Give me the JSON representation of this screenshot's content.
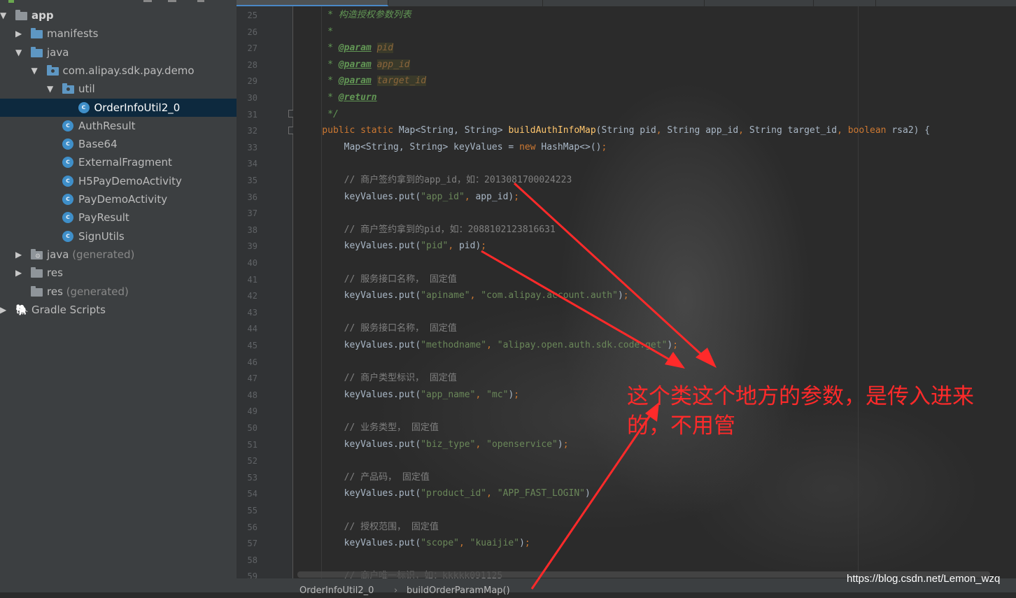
{
  "project_tree": {
    "nodes": [
      {
        "label": "app",
        "depth": 0,
        "icon": "module-folder-icon",
        "arrow": "▼"
      },
      {
        "label": "manifests",
        "depth": 1,
        "icon": "folder-icon",
        "arrow": "▶"
      },
      {
        "label": "java",
        "depth": 1,
        "icon": "folder-icon",
        "arrow": "▼"
      },
      {
        "label": "com.alipay.sdk.pay.demo",
        "depth": 2,
        "icon": "package-icon",
        "arrow": "▼"
      },
      {
        "label": "util",
        "depth": 3,
        "icon": "package-icon",
        "arrow": "▼"
      },
      {
        "label": "OrderInfoUtil2_0",
        "depth": 4,
        "icon": "class-icon",
        "selected": true
      },
      {
        "label": "AuthResult",
        "depth": 3,
        "icon": "class-icon"
      },
      {
        "label": "Base64",
        "depth": 3,
        "icon": "class-icon"
      },
      {
        "label": "ExternalFragment",
        "depth": 3,
        "icon": "class-icon"
      },
      {
        "label": "H5PayDemoActivity",
        "depth": 3,
        "icon": "class-icon"
      },
      {
        "label": "PayDemoActivity",
        "depth": 3,
        "icon": "class-icon"
      },
      {
        "label": "PayResult",
        "depth": 3,
        "icon": "class-icon"
      },
      {
        "label": "SignUtils",
        "depth": 3,
        "icon": "class-icon"
      },
      {
        "label": "java",
        "suffix": "(generated)",
        "depth": 1,
        "icon": "generated-folder-icon",
        "arrow": "▶"
      },
      {
        "label": "res",
        "depth": 1,
        "icon": "resource-folder-icon",
        "arrow": "▶"
      },
      {
        "label": "res",
        "suffix": "(generated)",
        "depth": 1,
        "icon": "resource-folder-icon"
      },
      {
        "label": "Gradle Scripts",
        "depth": 0,
        "icon": "gradle-icon",
        "arrow": "▶"
      }
    ]
  },
  "editor": {
    "line_numbers": [
      "25",
      "26",
      "27",
      "28",
      "29",
      "30",
      "31",
      "32",
      "33",
      "34",
      "35",
      "36",
      "37",
      "38",
      "39",
      "40",
      "41",
      "42",
      "43",
      "44",
      "45",
      "46",
      "47",
      "48",
      "49",
      "50",
      "51",
      "52",
      "53",
      "54",
      "55",
      "56",
      "57",
      "58",
      "59"
    ],
    "lines": [
      [
        {
          "t": "     * 构造授权参数列表",
          "c": "doc"
        }
      ],
      [
        {
          "t": "     *",
          "c": "doc"
        }
      ],
      [
        {
          "t": "     * ",
          "c": "doc"
        },
        {
          "t": "@param",
          "c": "tag"
        },
        {
          "t": " ",
          "c": "doc"
        },
        {
          "t": "pid",
          "c": "docval"
        }
      ],
      [
        {
          "t": "     * ",
          "c": "doc"
        },
        {
          "t": "@param",
          "c": "tag"
        },
        {
          "t": " ",
          "c": "doc"
        },
        {
          "t": "app_id",
          "c": "docval"
        }
      ],
      [
        {
          "t": "     * ",
          "c": "doc"
        },
        {
          "t": "@param",
          "c": "tag"
        },
        {
          "t": " ",
          "c": "doc"
        },
        {
          "t": "target_id",
          "c": "docval"
        }
      ],
      [
        {
          "t": "     * ",
          "c": "doc"
        },
        {
          "t": "@return",
          "c": "tag"
        }
      ],
      [
        {
          "t": "     */",
          "c": "doc"
        }
      ],
      [
        {
          "t": "    public static ",
          "c": "kw"
        },
        {
          "t": "Map<String, String> ",
          "c": ""
        },
        {
          "t": "buildAuthInfoMap",
          "c": "fn"
        },
        {
          "t": "(String pid",
          "c": ""
        },
        {
          "t": ", ",
          "c": "punct"
        },
        {
          "t": "String app_id",
          "c": ""
        },
        {
          "t": ", ",
          "c": "punct"
        },
        {
          "t": "String target_id",
          "c": ""
        },
        {
          "t": ", ",
          "c": "punct"
        },
        {
          "t": "boolean ",
          "c": "kw"
        },
        {
          "t": "rsa2) {",
          "c": ""
        }
      ],
      [
        {
          "t": "        Map<String, String> keyValues = ",
          "c": ""
        },
        {
          "t": "new ",
          "c": "kw"
        },
        {
          "t": "HashMap<>()",
          "c": ""
        },
        {
          "t": ";",
          "c": "punct"
        }
      ],
      [],
      [
        {
          "t": "        // 商户签约拿到的app_id，如：2013081700024223",
          "c": "cmt"
        }
      ],
      [
        {
          "t": "        keyValues.put(",
          "c": ""
        },
        {
          "t": "\"app_id\"",
          "c": "str"
        },
        {
          "t": ", ",
          "c": "punct"
        },
        {
          "t": "app_id)",
          "c": ""
        },
        {
          "t": ";",
          "c": "punct"
        }
      ],
      [],
      [
        {
          "t": "        // 商户签约拿到的pid，如：2088102123816631",
          "c": "cmt"
        }
      ],
      [
        {
          "t": "        keyValues.put(",
          "c": ""
        },
        {
          "t": "\"pid\"",
          "c": "str"
        },
        {
          "t": ", ",
          "c": "punct"
        },
        {
          "t": "pid)",
          "c": ""
        },
        {
          "t": ";",
          "c": "punct"
        }
      ],
      [],
      [
        {
          "t": "        // 服务接口名称， 固定值",
          "c": "cmt"
        }
      ],
      [
        {
          "t": "        keyValues.put(",
          "c": ""
        },
        {
          "t": "\"apiname\"",
          "c": "str"
        },
        {
          "t": ", ",
          "c": "punct"
        },
        {
          "t": "\"com.alipay.account.auth\"",
          "c": "str"
        },
        {
          "t": ")",
          "c": ""
        },
        {
          "t": ";",
          "c": "punct"
        }
      ],
      [],
      [
        {
          "t": "        // 服务接口名称， 固定值",
          "c": "cmt"
        }
      ],
      [
        {
          "t": "        keyValues.put(",
          "c": ""
        },
        {
          "t": "\"methodname\"",
          "c": "str"
        },
        {
          "t": ", ",
          "c": "punct"
        },
        {
          "t": "\"alipay.open.auth.sdk.code.get\"",
          "c": "str"
        },
        {
          "t": ")",
          "c": ""
        },
        {
          "t": ";",
          "c": "punct"
        }
      ],
      [],
      [
        {
          "t": "        // 商户类型标识， 固定值",
          "c": "cmt"
        }
      ],
      [
        {
          "t": "        keyValues.put(",
          "c": ""
        },
        {
          "t": "\"app_name\"",
          "c": "str"
        },
        {
          "t": ", ",
          "c": "punct"
        },
        {
          "t": "\"mc\"",
          "c": "str"
        },
        {
          "t": ")",
          "c": ""
        },
        {
          "t": ";",
          "c": "punct"
        }
      ],
      [],
      [
        {
          "t": "        // 业务类型， 固定值",
          "c": "cmt"
        }
      ],
      [
        {
          "t": "        keyValues.put(",
          "c": ""
        },
        {
          "t": "\"biz_type\"",
          "c": "str"
        },
        {
          "t": ", ",
          "c": "punct"
        },
        {
          "t": "\"openservice\"",
          "c": "str"
        },
        {
          "t": ")",
          "c": ""
        },
        {
          "t": ";",
          "c": "punct"
        }
      ],
      [],
      [
        {
          "t": "        // 产品码， 固定值",
          "c": "cmt"
        }
      ],
      [
        {
          "t": "        keyValues.put(",
          "c": ""
        },
        {
          "t": "\"product_id\"",
          "c": "str"
        },
        {
          "t": ", ",
          "c": "punct"
        },
        {
          "t": "\"APP_FAST_LOGIN\"",
          "c": "str"
        },
        {
          "t": ")",
          "c": ""
        }
      ],
      [],
      [
        {
          "t": "        // 授权范围， 固定值",
          "c": "cmt"
        }
      ],
      [
        {
          "t": "        keyValues.put(",
          "c": ""
        },
        {
          "t": "\"scope\"",
          "c": "str"
        },
        {
          "t": ", ",
          "c": "punct"
        },
        {
          "t": "\"kuaijie\"",
          "c": "str"
        },
        {
          "t": ")",
          "c": ""
        },
        {
          "t": ";",
          "c": "punct"
        }
      ],
      [],
      [
        {
          "t": "        // 商户唯一标识，如：kkkkk091125",
          "c": "cmt"
        }
      ]
    ]
  },
  "statusbar": {
    "crumb_class": "OrderInfoUtil2_0",
    "separator": "›",
    "crumb_method": "buildOrderParamMap()"
  },
  "annotation": {
    "text": "这个类这个地方的参数，是传入进来的，不用管",
    "color": "#ff2a2a"
  },
  "watermark": "https://blog.csdn.net/Lemon_wzq",
  "colors": {
    "tree_bg": "#3c3f41",
    "selection": "#0d293e",
    "editor_bg": "#2b2b2b",
    "keyword": "#cc7832",
    "string": "#6a8759",
    "comment": "#808080",
    "method": "#ffc66d"
  }
}
